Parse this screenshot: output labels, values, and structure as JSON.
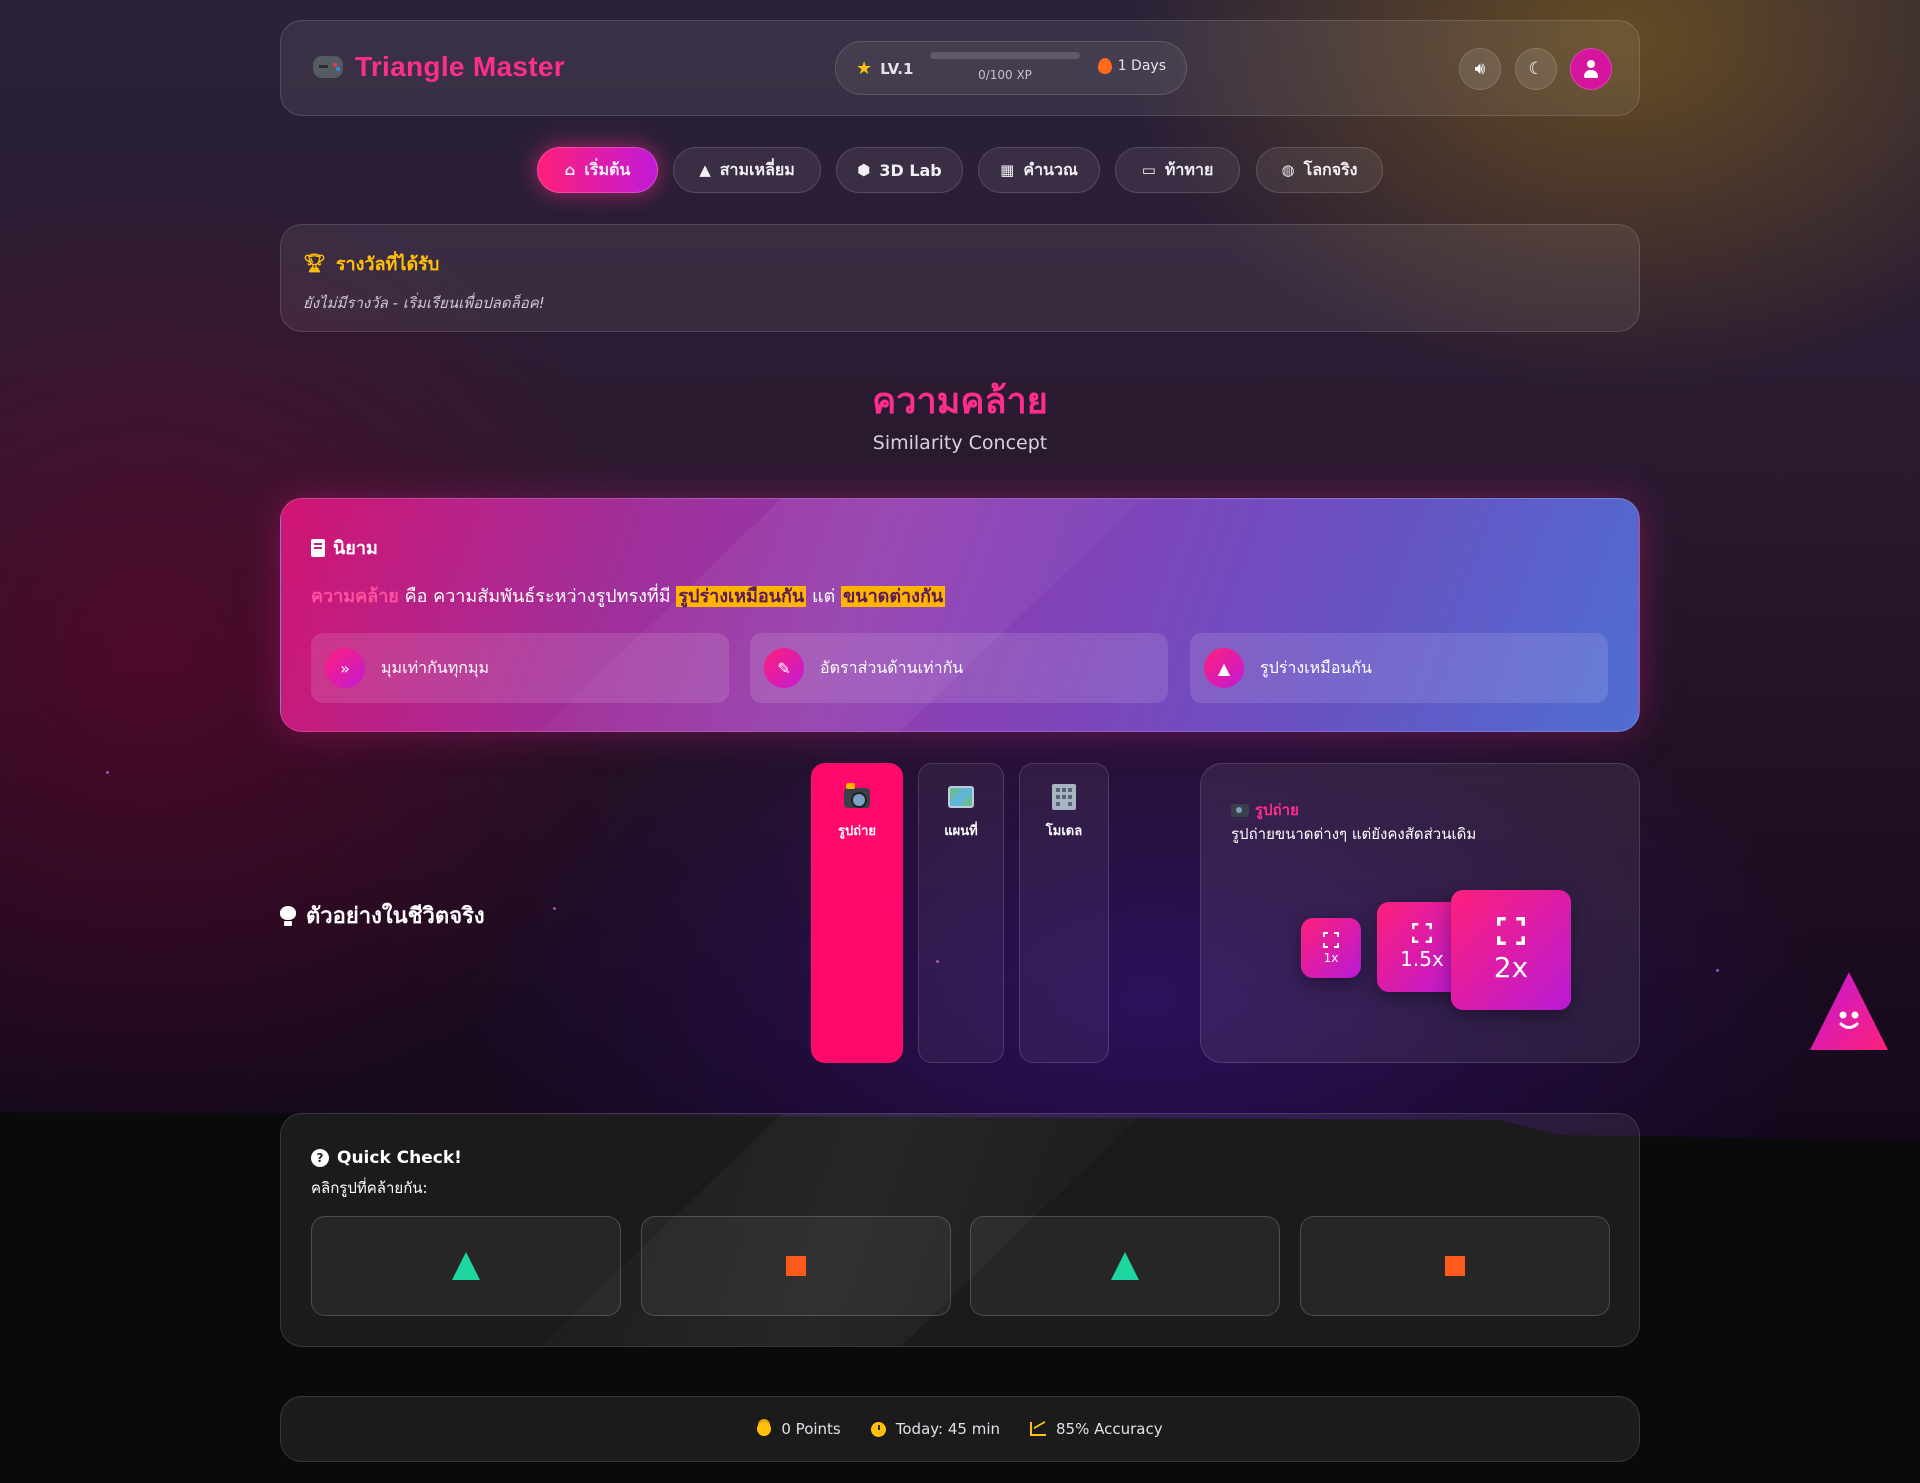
{
  "header": {
    "title": "Triangle Master",
    "level_label": "LV.1",
    "xp_text": "0/100 XP",
    "xp_progress": 0,
    "streak_text": "1 Days",
    "icons": [
      "gamepad-icon",
      "star-icon",
      "flame-icon",
      "volume-icon",
      "moon-icon",
      "user-icon"
    ]
  },
  "nav": {
    "items": [
      {
        "label": "เริ่มต้น",
        "icon": "home-icon",
        "active": true
      },
      {
        "label": "สามเหลี่ยม",
        "icon": "shapes-icon",
        "active": false
      },
      {
        "label": "3D Lab",
        "icon": "cube-icon",
        "active": false
      },
      {
        "label": "คำนวณ",
        "icon": "calculator-icon",
        "active": false
      },
      {
        "label": "ท้าทาย",
        "icon": "gamepad-icon",
        "active": false
      },
      {
        "label": "โลกจริง",
        "icon": "globe-icon",
        "active": false
      }
    ]
  },
  "awards": {
    "title": "รางวัลที่ได้รับ",
    "empty_text": "ยังไม่มีรางวัล - เริ่มเรียนเพื่อปลดล็อค!"
  },
  "page": {
    "title": "ความคล้าย",
    "subtitle": "Similarity Concept"
  },
  "definition": {
    "heading": "นิยาม",
    "term": "ความคล้าย",
    "text_a": " คือ ความสัมพันธ์ระหว่างรูปทรงที่มี ",
    "highlight_a": "รูปร่างเหมือนกัน",
    "text_b": " แต่ ",
    "highlight_b": "ขนาดต่างกัน",
    "features": [
      {
        "label": "มุมเท่ากันทุกมุม",
        "icon": "double-chevron-icon"
      },
      {
        "label": "อัตราส่วนด้านเท่ากัน",
        "icon": "ruler-icon"
      },
      {
        "label": "รูปร่างเหมือนกัน",
        "icon": "shapes-icon"
      }
    ]
  },
  "real_life": {
    "title": "ตัวอย่างในชีวิตจริง",
    "tabs": [
      {
        "label": "รูปถ่าย",
        "icon": "camera-icon",
        "active": true
      },
      {
        "label": "แผนที่",
        "icon": "map-icon",
        "active": false
      },
      {
        "label": "โมเดล",
        "icon": "building-icon",
        "active": false
      }
    ],
    "panel": {
      "title": "รูปถ่าย",
      "description": "รูปถ่ายขนาดต่างๆ แต่ยังคงสัดส่วนเดิม",
      "scales": [
        "1x",
        "1.5x",
        "2x"
      ]
    }
  },
  "quick_check": {
    "title": "Quick Check!",
    "subtitle": "คลิกรูปที่คล้ายกัน:",
    "options": [
      {
        "shape": "triangle",
        "color": "#1ed6a0"
      },
      {
        "shape": "square",
        "color": "#ff5a1a"
      },
      {
        "shape": "triangle",
        "color": "#1ed6a0"
      },
      {
        "shape": "square",
        "color": "#ff5a1a"
      }
    ]
  },
  "stats": {
    "points": "0 Points",
    "today": "Today: 45 min",
    "accuracy": "85% Accuracy"
  },
  "colors": {
    "accent": "#ff2d8c",
    "gold": "#ffc107",
    "highlight": "#ffb400",
    "active_tab": "#ff0a6c"
  }
}
